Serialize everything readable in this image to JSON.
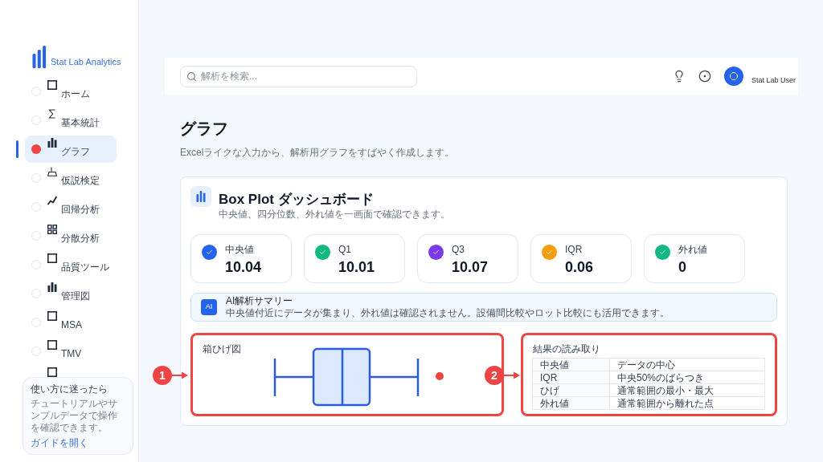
{
  "sidebar": {
    "brand": "Stat Lab Analytics",
    "items": [
      {
        "label": "ホーム",
        "kind": "square",
        "selected": false
      },
      {
        "label": "基本統計",
        "kind": "sigma",
        "selected": false
      },
      {
        "label": "グラフ",
        "kind": "bars",
        "selected": true
      },
      {
        "label": "仮説検定",
        "kind": "flask",
        "selected": false
      },
      {
        "label": "回帰分析",
        "kind": "trend",
        "selected": false
      },
      {
        "label": "分散分析",
        "kind": "grid",
        "selected": false
      },
      {
        "label": "品質ツール",
        "kind": "square",
        "selected": false
      },
      {
        "label": "管理図",
        "kind": "bars",
        "selected": false
      },
      {
        "label": "MSA",
        "kind": "square",
        "selected": false
      },
      {
        "label": "TMV",
        "kind": "square",
        "selected": false
      },
      {
        "kind": "square"
      }
    ],
    "help": {
      "title": "使い方に迷ったら",
      "text": "チュートリアルやサンプルデータで操作を確認できます。",
      "link": "ガイドを開く"
    }
  },
  "header": {
    "search": {
      "placeholder": "解析を検索..."
    },
    "user": "Stat Lab User"
  },
  "page": {
    "title": "グラフ",
    "subtitle": "Excelライクな入力から、解析用グラフをすばやく作成します。"
  },
  "dashboard": {
    "title": "Box Plot ダッシュボード",
    "subtitle": "中央値、四分位数、外れ値を一画面で確認できます。",
    "metrics": [
      {
        "label": "中央値",
        "value": "10.04",
        "color": "#2563eb"
      },
      {
        "label": "Q1",
        "value": "10.01",
        "color": "#10b981"
      },
      {
        "label": "Q3",
        "value": "10.07",
        "color": "#7c3aed"
      },
      {
        "label": "IQR",
        "value": "0.06",
        "color": "#f59e0b"
      },
      {
        "label": "外れ値",
        "value": "0",
        "color": "#10b981"
      }
    ],
    "summary": {
      "badge": "AI",
      "title": "AI解析サマリー",
      "text": "中央値付近にデータが集まり、外れ値は確認されません。設備間比較やロット比較にも活用できます。"
    },
    "chart_panel": {
      "title": "箱ひげ図",
      "highlighted": true,
      "callout": "1"
    },
    "table_panel": {
      "title": "結果の読み取り",
      "highlighted": true,
      "callout": "2",
      "rows": [
        [
          "中央値",
          "データの中心"
        ],
        [
          "IQR",
          "中央50%のばらつき"
        ],
        [
          "ひげ",
          "通常範囲の最小・最大"
        ],
        [
          "外れ値",
          "通常範囲から離れた点"
        ]
      ]
    }
  }
}
